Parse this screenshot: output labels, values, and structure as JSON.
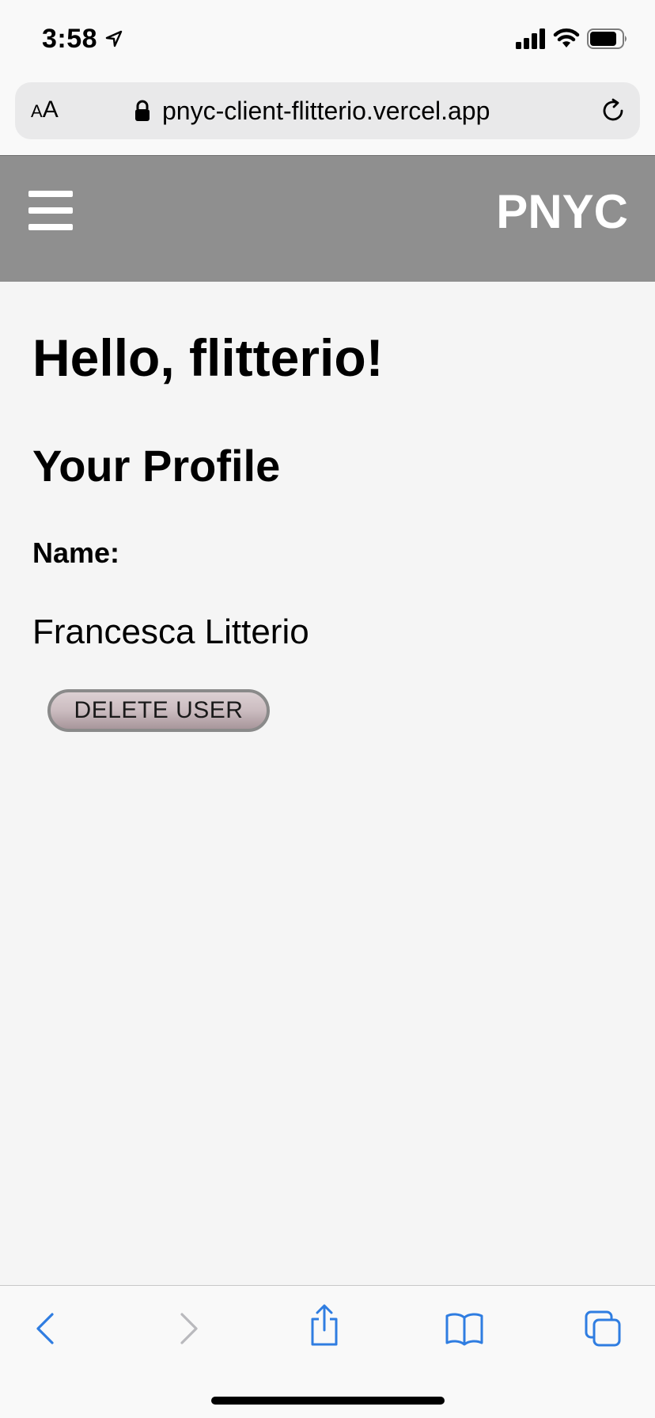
{
  "status_bar": {
    "time": "3:58"
  },
  "browser": {
    "aa_label_small": "A",
    "aa_label_large": "A",
    "url": "pnyc-client-flitterio.vercel.app"
  },
  "app": {
    "brand": "PNYC"
  },
  "page": {
    "greeting": "Hello, flitterio!",
    "profile_heading": "Your Profile",
    "name_label": "Name:",
    "name_value": "Francesca Litterio",
    "delete_button_label": "DELETE USER"
  },
  "colors": {
    "header_bg": "#8f8f8f",
    "page_bg": "#f5f5f5",
    "toolbar_accent": "#2f7de1"
  }
}
